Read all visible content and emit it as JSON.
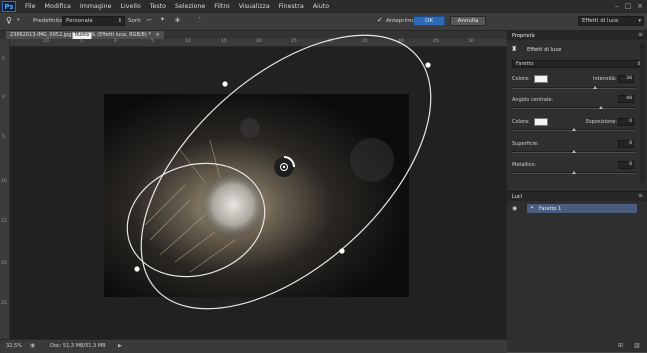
{
  "app": {
    "logo_text": "Ps"
  },
  "menu": {
    "items": [
      "File",
      "Modifica",
      "Immagine",
      "Livello",
      "Testo",
      "Selezione",
      "Filtro",
      "Visualizza",
      "Finestra",
      "Aiuto"
    ]
  },
  "window_controls": {
    "minimize": "–",
    "maximize": "□",
    "close": "×"
  },
  "options_bar": {
    "preset_label": "Predefinito:",
    "preset_value": "Personale",
    "softness_label": "Sorti",
    "preview_label": "Anteprima",
    "preview_checked": true,
    "ok_label": "OK",
    "cancel_label": "Annulla",
    "workspace_value": "Effetti di luce"
  },
  "document": {
    "tab_title": "23062013-IMG_0052.jpg @ 32,5% (Effetti luce, RGB/8) *",
    "tooltip": "Ruota",
    "ruler_top": [
      "10",
      "5",
      "0",
      "5",
      "10",
      "15",
      "20",
      "25",
      "30",
      "35",
      "40",
      "45",
      "50"
    ],
    "ruler_left": [
      "5",
      "0",
      "5",
      "10",
      "15",
      "20",
      "25"
    ]
  },
  "status": {
    "zoom": "32,5%",
    "doc_info": "Doc: 51,3 MB/51,3 MB"
  },
  "properties_panel": {
    "tab": "Proprietà",
    "title": "Effetti di luce",
    "light_type": "Faretto",
    "color_label": "Colore:",
    "intensity_label": "Intensità:",
    "intensity_value": "34",
    "hotspot_label": "Angolo centrale:",
    "hotspot_value": "44",
    "colorize_label": "Colora:",
    "exposure_label": "Esposizione:",
    "exposure_value": "0",
    "gloss_label": "Superficie:",
    "gloss_value": "0",
    "metallic_label": "Metallico:",
    "metallic_value": "0",
    "sliders": {
      "intensity": 0.67,
      "hotspot": 0.72,
      "exposure": 0.5,
      "gloss": 0.5,
      "metallic": 0.5
    }
  },
  "lights_panel": {
    "tab": "Luci",
    "items": [
      {
        "label": "Faretto 1"
      }
    ]
  },
  "colors": {
    "accent": "#2f6bb5",
    "selected_row": "#4a5d7e",
    "swatch": "#f4f4f4"
  }
}
